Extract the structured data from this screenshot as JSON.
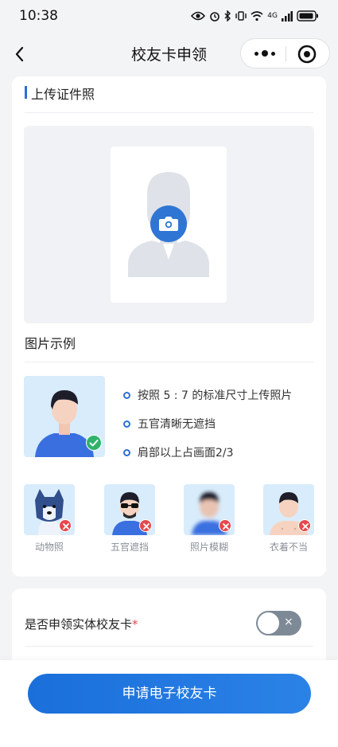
{
  "status_bar": {
    "time": "10:38",
    "network": "4G"
  },
  "nav": {
    "title": "校友卡申领",
    "back_icon": "chevron-left-icon",
    "more_icon": "more-dots-icon",
    "close_icon": "target-circle-icon"
  },
  "upload_section": {
    "title": "上传证件照",
    "camera_icon": "camera-icon"
  },
  "examples_section": {
    "title": "图片示例",
    "tips": [
      "按照 5 : 7 的标准尺寸上传照片",
      "五官清晰无遮挡",
      "肩部以上占画面2/3"
    ],
    "bad_examples": [
      {
        "label": "动物照"
      },
      {
        "label": "五官遮挡"
      },
      {
        "label": "照片模糊"
      },
      {
        "label": "衣着不当"
      }
    ]
  },
  "physical_card": {
    "label": "是否申领实体校友卡",
    "required_mark": "*",
    "toggle_on": false,
    "toggle_icon": "×"
  },
  "footer": {
    "apply_label": "申请电子校友卡"
  },
  "colors": {
    "accent": "#2b6fd6",
    "danger": "#e5484d",
    "toggle_off": "#7d8a96"
  }
}
